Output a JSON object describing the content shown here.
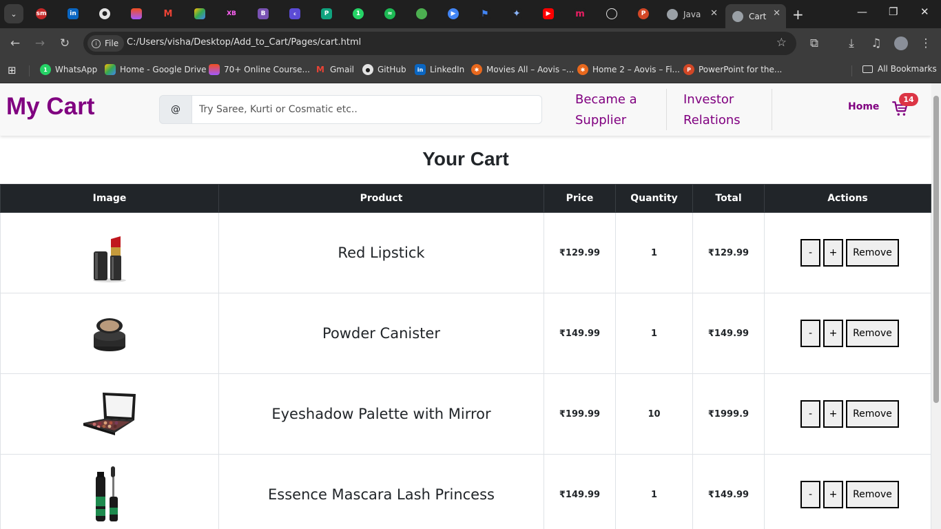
{
  "browser": {
    "pinned_tabs": [
      "sm-icon",
      "linkedin-icon",
      "github-icon",
      "figma-icon",
      "gmail-icon",
      "google-drive-icon",
      "xd-icon",
      "bootstrap-icon",
      "coolors-icon",
      "copilot-icon",
      "whatsapp-icon",
      "spotify-icon",
      "green-circle-icon",
      "play-icon",
      "flag-icon",
      "gemini-icon",
      "youtube-icon",
      "m-icon",
      "chatgpt-icon",
      "powerpoint-icon"
    ],
    "tabs": [
      {
        "title": "Java",
        "active": false
      },
      {
        "title": "Cart",
        "active": true
      }
    ],
    "new_tab_label": "+",
    "address": {
      "chip_label": "File",
      "url": "C:/Users/visha/Desktop/Add_to_Cart/Pages/cart.html"
    },
    "bookmarks": [
      {
        "label": "WhatsApp",
        "icon": "whatsapp-icon"
      },
      {
        "label": "Home - Google Drive",
        "icon": "google-drive-icon"
      },
      {
        "label": "70+ Online Course...",
        "icon": "figma-icon"
      },
      {
        "label": "Gmail",
        "icon": "gmail-icon"
      },
      {
        "label": "GitHub",
        "icon": "github-icon"
      },
      {
        "label": "LinkedIn",
        "icon": "linkedin-icon"
      },
      {
        "label": "Movies All – Aovis –...",
        "icon": "film-reel-icon"
      },
      {
        "label": "Home 2 – Aovis – Fi...",
        "icon": "film-reel-icon"
      },
      {
        "label": "PowerPoint for the...",
        "icon": "powerpoint-icon"
      }
    ],
    "all_bookmarks_label": "All Bookmarks"
  },
  "site": {
    "brand": "My Cart",
    "search": {
      "addon": "@",
      "placeholder": "Try Saree, Kurti or Cosmatic etc.."
    },
    "nav": {
      "supplier": [
        "Became a",
        "Supplier"
      ],
      "investor": [
        "Investor",
        "Relations"
      ],
      "home": "Home"
    },
    "cart_count": "14",
    "brand_color": "#800080"
  },
  "cart": {
    "title": "Your Cart",
    "columns": [
      "Image",
      "Product",
      "Price",
      "Quantity",
      "Total",
      "Actions"
    ],
    "rows": [
      {
        "image": "lipstick-image",
        "product": "Red Lipstick",
        "price": "₹129.99",
        "quantity": "1",
        "total": "₹129.99"
      },
      {
        "image": "powder-canister-image",
        "product": "Powder Canister",
        "price": "₹149.99",
        "quantity": "1",
        "total": "₹149.99"
      },
      {
        "image": "eyeshadow-palette-image",
        "product": "Eyeshadow Palette with Mirror",
        "price": "₹199.99",
        "quantity": "10",
        "total": "₹1999.9"
      },
      {
        "image": "mascara-image",
        "product": "Essence Mascara Lash Princess",
        "price": "₹149.99",
        "quantity": "1",
        "total": "₹149.99"
      }
    ],
    "actions": {
      "decrement": "-",
      "increment": "+",
      "remove": "Remove"
    }
  }
}
